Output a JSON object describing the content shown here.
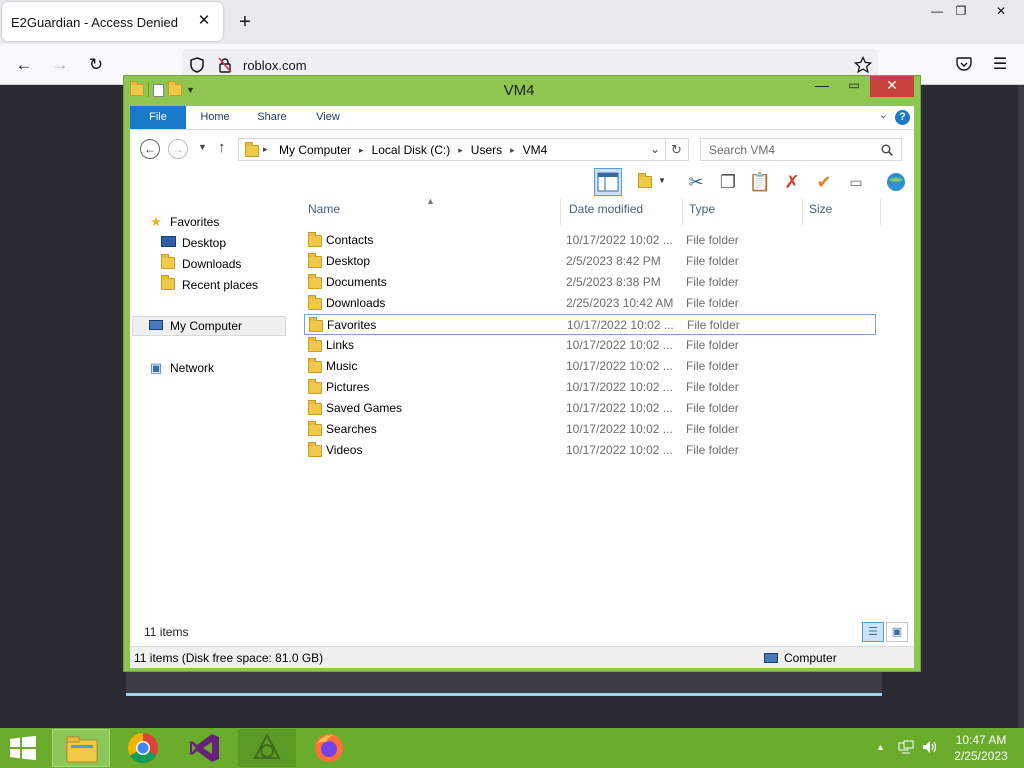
{
  "browser": {
    "tab_title": "E2Guardian - Access Denied",
    "tab_close": "✕",
    "new_tab": "+",
    "url": "roblox.com",
    "window_controls": [
      "—",
      "❐",
      "✕"
    ]
  },
  "explorer": {
    "window_title": "VM4",
    "ribbon_tabs": [
      "File",
      "Home",
      "Share",
      "View"
    ],
    "breadcrumb": [
      "My Computer",
      "Local Disk (C:)",
      "Users",
      "VM4"
    ],
    "search_placeholder": "Search VM4",
    "nav": {
      "favorites": "Favorites",
      "desktop": "Desktop",
      "downloads": "Downloads",
      "recent": "Recent places",
      "my_computer": "My Computer",
      "network": "Network"
    },
    "columns": {
      "name": "Name",
      "date": "Date modified",
      "type": "Type",
      "size": "Size"
    },
    "files": [
      {
        "name": "Contacts",
        "date": "10/17/2022 10:02 ...",
        "type": "File folder",
        "icon": "contacts-folder-icon"
      },
      {
        "name": "Desktop",
        "date": "2/5/2023 8:42 PM",
        "type": "File folder",
        "icon": "desktop-folder-icon"
      },
      {
        "name": "Documents",
        "date": "2/5/2023 8:38 PM",
        "type": "File folder",
        "icon": "documents-folder-icon"
      },
      {
        "name": "Downloads",
        "date": "2/25/2023 10:42 AM",
        "type": "File folder",
        "icon": "downloads-folder-icon"
      },
      {
        "name": "Favorites",
        "date": "10/17/2022 10:02 ...",
        "type": "File folder",
        "icon": "favorites-folder-icon"
      },
      {
        "name": "Links",
        "date": "10/17/2022 10:02 ...",
        "type": "File folder",
        "icon": "links-folder-icon"
      },
      {
        "name": "Music",
        "date": "10/17/2022 10:02 ...",
        "type": "File folder",
        "icon": "music-folder-icon"
      },
      {
        "name": "Pictures",
        "date": "10/17/2022 10:02 ...",
        "type": "File folder",
        "icon": "pictures-folder-icon"
      },
      {
        "name": "Saved Games",
        "date": "10/17/2022 10:02 ...",
        "type": "File folder",
        "icon": "saved-games-folder-icon"
      },
      {
        "name": "Searches",
        "date": "10/17/2022 10:02 ...",
        "type": "File folder",
        "icon": "searches-folder-icon"
      },
      {
        "name": "Videos",
        "date": "10/17/2022 10:02 ...",
        "type": "File folder",
        "icon": "videos-folder-icon"
      }
    ],
    "item_count": "11 items",
    "status_text": "11 items (Disk free space: 81.0 GB)",
    "status_location": "Computer"
  },
  "taskbar": {
    "apps": [
      "file-explorer",
      "chrome",
      "visual-studio",
      "app-generic",
      "firefox"
    ],
    "clock_time": "10:47 AM",
    "clock_date": "2/25/2023"
  },
  "colors": {
    "window_frame": "#8fc64f",
    "taskbar": "#6aad2d",
    "ribbon_file_tab": "#1979ca",
    "close_button": "#c7413d"
  }
}
